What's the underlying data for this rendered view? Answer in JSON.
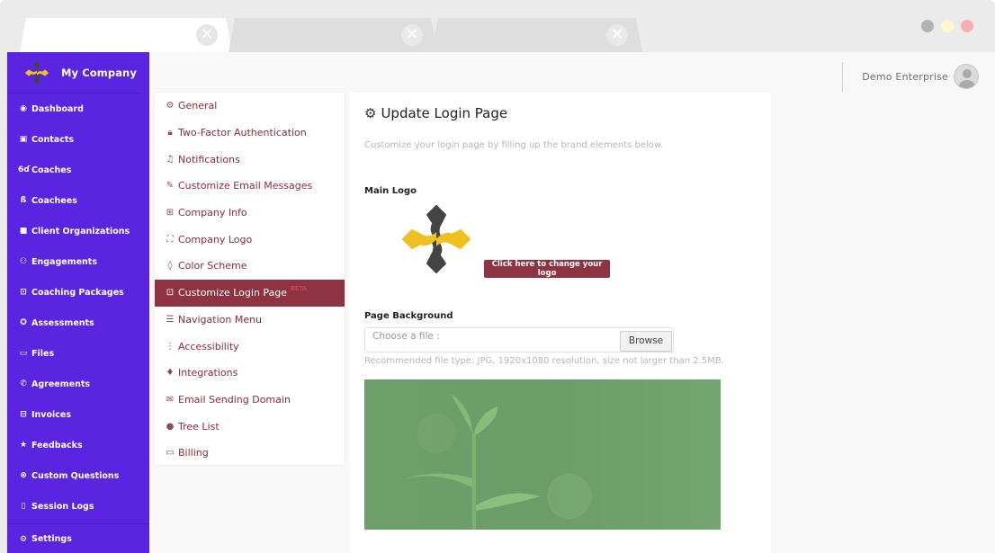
{
  "browser": {
    "tabs": [
      {
        "label": "",
        "active": true
      },
      {
        "label": "",
        "active": false
      },
      {
        "label": "",
        "active": false
      }
    ],
    "close_glyph": "✕",
    "window_dots": [
      {
        "name": "minimize",
        "color": "#b3b3b3"
      },
      {
        "name": "maximize",
        "color": "#fcf8cf"
      },
      {
        "name": "close",
        "color": "#f7b0b1"
      }
    ]
  },
  "colors": {
    "sidebar_bg": "#5b24e0",
    "accent": "#8e3342",
    "beta": "#e8505f",
    "logo_yellow": "#f0c020",
    "logo_dark": "#444444"
  },
  "sidebar": {
    "brand_name": "My Company",
    "items": [
      {
        "label": "Dashboard",
        "icon": "dashboard-icon",
        "glyph": "◉"
      },
      {
        "label": "Contacts",
        "icon": "contacts-icon",
        "glyph": "▣"
      },
      {
        "label": "Coaches",
        "icon": "glasses-icon",
        "glyph": "6ɗ"
      },
      {
        "label": "Coachees",
        "icon": "user-group-icon",
        "glyph": "ß"
      },
      {
        "label": "Client Organizations",
        "icon": "building-icon",
        "glyph": "■"
      },
      {
        "label": "Engagements",
        "icon": "users-icon",
        "glyph": "⚇"
      },
      {
        "label": "Coaching Packages",
        "icon": "inbox-icon",
        "glyph": "⊡"
      },
      {
        "label": "Assessments",
        "icon": "refresh-icon",
        "glyph": "✪"
      },
      {
        "label": "Files",
        "icon": "folder-icon",
        "glyph": "▭"
      },
      {
        "label": "Agreements",
        "icon": "handshake-icon",
        "glyph": "✆"
      },
      {
        "label": "Invoices",
        "icon": "money-icon",
        "glyph": "⊟"
      },
      {
        "label": "Feedbacks",
        "icon": "star-icon",
        "glyph": "★"
      },
      {
        "label": "Custom Questions",
        "icon": "question-comment-icon",
        "glyph": "⊕"
      },
      {
        "label": "Session Logs",
        "icon": "book-icon",
        "glyph": "▯"
      },
      {
        "label": "Settings",
        "icon": "gear-icon",
        "glyph": "⚙"
      }
    ]
  },
  "header": {
    "user_name": "Demo Enterprise"
  },
  "settings_menu": {
    "items": [
      {
        "label": "General",
        "icon": "gear-icon",
        "glyph": "⚙",
        "active": false
      },
      {
        "label": "Two-Factor Authentication",
        "icon": "lock-icon",
        "glyph": "🔒︎",
        "active": false
      },
      {
        "label": "Notifications",
        "icon": "bell-icon",
        "glyph": "♫",
        "active": false
      },
      {
        "label": "Customize Email Messages",
        "icon": "pencil-icon",
        "glyph": "✎",
        "active": false
      },
      {
        "label": "Company Info",
        "icon": "briefcase-icon",
        "glyph": "⊞",
        "active": false
      },
      {
        "label": "Company Logo",
        "icon": "expand-icon",
        "glyph": "⛶",
        "active": false
      },
      {
        "label": "Color Scheme",
        "icon": "droplet-icon",
        "glyph": "◊",
        "active": false
      },
      {
        "label": "Customize Login Page",
        "icon": "sign-in-icon",
        "glyph": "⊡",
        "active": true,
        "badge": "BETA"
      },
      {
        "label": "Navigation Menu",
        "icon": "menu-icon",
        "glyph": "☰",
        "active": false
      },
      {
        "label": "Accessibility",
        "icon": "more-vertical-icon",
        "glyph": "⋮",
        "active": false
      },
      {
        "label": "Integrations",
        "icon": "plug-icon",
        "glyph": "♦",
        "active": false
      },
      {
        "label": "Email Sending Domain",
        "icon": "envelope-icon",
        "glyph": "✉",
        "active": false
      },
      {
        "label": "Tree List",
        "icon": "tree-icon",
        "glyph": "●",
        "active": false
      },
      {
        "label": "Billing",
        "icon": "credit-card-icon",
        "glyph": "▭",
        "active": false
      }
    ]
  },
  "main": {
    "title": "Update Login Page",
    "subtitle": "Customize your login page by filling up the brand elements below.",
    "main_logo_label": "Main Logo",
    "change_logo_button": "Click here to change your logo",
    "page_background_label": "Page Background",
    "file_placeholder": "Choose a file :",
    "browse_button": "Browse",
    "file_hint": "Recommended file type: JPG, 1920x1080 resolution, size not larger than 2.5MB."
  }
}
